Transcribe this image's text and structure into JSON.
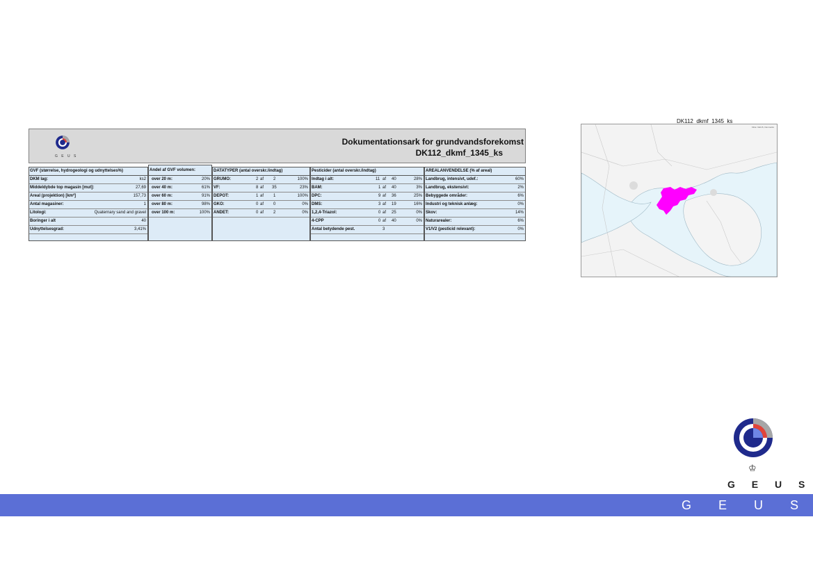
{
  "sheet": {
    "logo_word": "G E U S",
    "title_line1": "Dokumentationsark for grundvandsforekomst",
    "title_line2": "DK112_dkmf_1345_ks",
    "col1": {
      "header": "GVF (størrelse, hydrogeologi og udnyttelses%)",
      "rows": [
        {
          "label": "DKM lag:",
          "value": "ks2"
        },
        {
          "label": "Middeldybde top magasin [mut]:",
          "value": "27,69"
        },
        {
          "label": "Areal (projektion) [km²]",
          "value": "157,73"
        },
        {
          "label": "Antal magasiner:",
          "value": "1"
        },
        {
          "label": "Litologi:",
          "value": "Quaternary sand and gravel"
        },
        {
          "label": "Boringer i alt",
          "value": "40"
        },
        {
          "label": "Udnyttelsesgrad:",
          "value": "3,41%"
        }
      ]
    },
    "col2": {
      "header": "Andel af GVF volumen:",
      "rows": [
        {
          "label": "over 20 m:",
          "value": "20%"
        },
        {
          "label": "over 40 m:",
          "value": "61%"
        },
        {
          "label": "over 60 m:",
          "value": "91%"
        },
        {
          "label": "over 80 m:",
          "value": "98%"
        },
        {
          "label": "over 100 m:",
          "value": "100%"
        }
      ]
    },
    "col3": {
      "header": "DATATYPER (antal overskr./indtag)",
      "rows": [
        {
          "label": "GRUMO:",
          "n": "2",
          "af": "af",
          "m": "2",
          "pct": "100%"
        },
        {
          "label": "VF:",
          "n": "8",
          "af": "af",
          "m": "35",
          "pct": "23%"
        },
        {
          "label": "DEPOT:",
          "n": "1",
          "af": "af",
          "m": "1",
          "pct": "100%"
        },
        {
          "label": "GKO:",
          "n": "0",
          "af": "af",
          "m": "0",
          "pct": "0%"
        },
        {
          "label": "ANDET:",
          "n": "0",
          "af": "af",
          "m": "2",
          "pct": "0%"
        }
      ]
    },
    "col4": {
      "header": "Pesticider (antal overskr./indtag)",
      "rows": [
        {
          "label": "Indtag i alt:",
          "n": "11",
          "af": "af",
          "m": "40",
          "pct": "28%"
        },
        {
          "label": "BAM:",
          "n": "1",
          "af": "af",
          "m": "40",
          "pct": "3%"
        },
        {
          "label": "DPC:",
          "n": "9",
          "af": "af",
          "m": "36",
          "pct": "25%"
        },
        {
          "label": "DMS:",
          "n": "3",
          "af": "af",
          "m": "19",
          "pct": "16%"
        },
        {
          "label": "1,2,4-Triazol:",
          "n": "0",
          "af": "af",
          "m": "25",
          "pct": "0%"
        },
        {
          "label": "4-CPP",
          "n": "0",
          "af": "af",
          "m": "40",
          "pct": "0%"
        }
      ],
      "last_label": "Antal betydende pest.",
      "last_value": "3"
    },
    "col5": {
      "header": "AREALANVENDELSE (% af areal)",
      "rows": [
        {
          "label": "Landbrug, intensivt, udef.:",
          "value": "60%"
        },
        {
          "label": "Landbrug, ekstensivt:",
          "value": "2%"
        },
        {
          "label": "Bebyggede områder:",
          "value": "6%"
        },
        {
          "label": "Industri og teknisk anlæg:",
          "value": "0%"
        },
        {
          "label": "Skov:",
          "value": "14%"
        },
        {
          "label": "Naturarealer:",
          "value": "6%"
        },
        {
          "label": "V1/V2 (pesticid relevant):",
          "value": "0%"
        }
      ]
    }
  },
  "map": {
    "title": "DK112_dkmf_1345_ks",
    "credit": "Kilde: GEUS, Danmarks",
    "highlight_color": "#ff00ff",
    "water_color": "#e6f4fa"
  },
  "branding": {
    "word": "G E U S",
    "footer_word": "G E U S",
    "crown_glyph": "♔",
    "band_color": "#5b6fd6",
    "logo_blue": "#1f2a8c",
    "logo_red": "#e0443a",
    "logo_gray": "#a6a6a6"
  }
}
